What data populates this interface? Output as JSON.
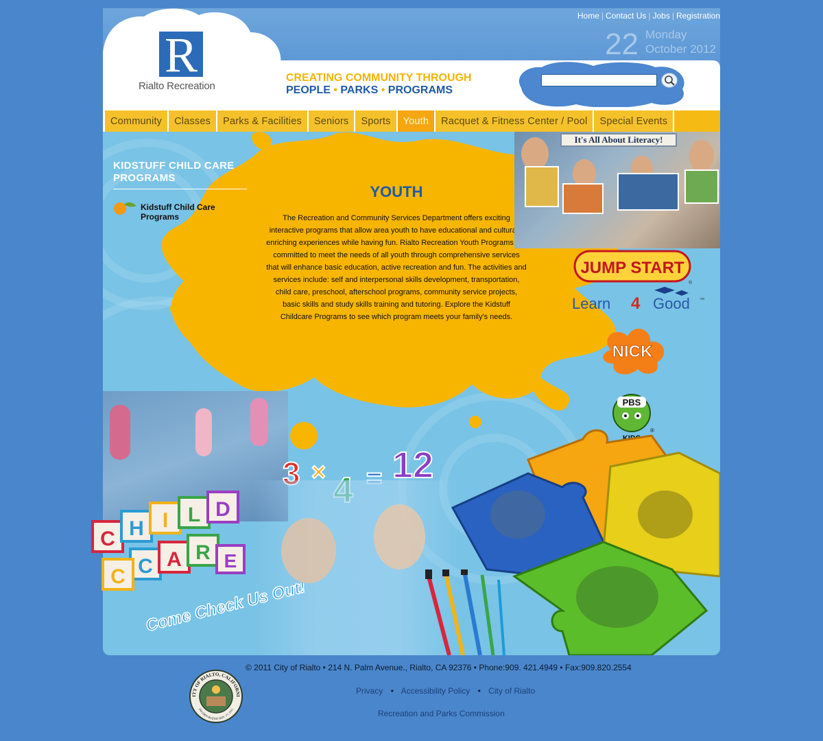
{
  "header": {
    "logo_text": "Rialto Recreation",
    "logo_letter": "R",
    "tagline_line1": "CREATING COMMUNITY THROUGH",
    "tagline_people": "PEOPLE",
    "tagline_parks": "PARKS",
    "tagline_programs": "PROGRAMS",
    "tagline_dot": "•",
    "top_links": [
      "Home",
      "Contact Us",
      "Jobs",
      "Registration"
    ],
    "top_link_sep": "|",
    "date_number": "22",
    "date_weekday": "Monday",
    "date_month_year": "October 2012",
    "search": {
      "value": "",
      "placeholder": ""
    }
  },
  "nav": {
    "items": [
      "Community",
      "Classes",
      "Parks & Facilities",
      "Seniors",
      "Sports",
      "Youth",
      "Racquet & Fitness Center / Pool",
      "Special Events"
    ],
    "active": "Youth"
  },
  "sidebar": {
    "title": "KIDSTUFF CHILD CARE PROGRAMS",
    "links": [
      "Kidstuff Child Care Programs"
    ]
  },
  "main": {
    "title": "YOUTH",
    "body": "The Recreation and Community Services Department offers exciting interactive programs that allow area youth to have educational and culturally enriching experiences while having fun. Rialto Recreation Youth Programs are committed to meet the needs of all youth through comprehensive services that will enhance basic education, active recreation and fun. The activities and services include: self and interpersonal skills development, transportation, child care, preschool, afterschool programs, community service projects, basic skills and study skills training and tutoring. Explore the Kidstuff Childcare Programs to see which program meets your family's needs."
  },
  "graphics": {
    "literacy_sign": "It's All About Literacy!",
    "jumpstart": "JUMP START",
    "learn4good_a": "Learn",
    "learn4good_4": "4",
    "learn4good_b": "Good",
    "trademark": "™",
    "registered": "®",
    "nick": "NICK",
    "pbs": "PBS",
    "pbs_kids": "KIDS",
    "math_3": "3",
    "math_x": "×",
    "math_4": "4",
    "math_eq": "=",
    "math_12": "12",
    "blocks_child": [
      "C",
      "H",
      "I",
      "L",
      "D"
    ],
    "blocks_care": [
      "C",
      "A",
      "R",
      "E"
    ],
    "blocks_c": "C",
    "come_check": "Come Check Us Out!"
  },
  "footer": {
    "copyright": "© 2011 City of Rialto • 214 N. Palm Avenue., Rialto, CA 92376 • Phone:909. 421.4949 • Fax:909.820.2554",
    "links": [
      "Privacy",
      "Accessibility Policy",
      "City of Rialto"
    ],
    "bullet": "•",
    "commission_link": "Recreation and Parks Commission",
    "seal_text": "CITY OF RIALTO, CALIFORNIA",
    "seal_incorporated": "INCORPORATED NOV. 17, 1911"
  },
  "colors": {
    "page_bg": "#4a86cb",
    "nav_yellow": "#f5bb14",
    "nav_active": "#f5a611",
    "title_blue": "#1f5aa6",
    "tagline_yellow": "#f2b400",
    "panel_blue": "#79c3e6",
    "splat_orange": "#f7b500"
  }
}
